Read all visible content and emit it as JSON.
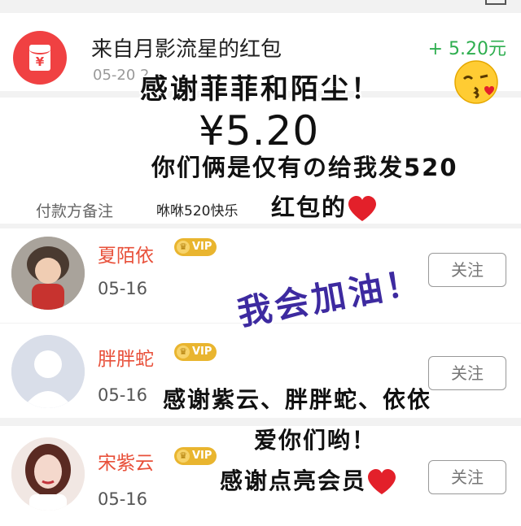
{
  "red_packet": {
    "from_title": "来自月影流星的红包",
    "amount": "+ 5.20元",
    "date": "05-20 2",
    "envelope_symbol": "¥",
    "envelope_icon": "red-envelope-icon"
  },
  "detail": {
    "amount_big": "¥5.20",
    "remark_label": "付款方备注",
    "remark_value": "咻咻520快乐"
  },
  "users": [
    {
      "name": "夏陌依",
      "vip": "VIP",
      "date": "05-16",
      "follow": "关注"
    },
    {
      "name": "胖胖蛇",
      "vip": "VIP",
      "date": "05-16",
      "follow": "关注"
    },
    {
      "name": "宋紫云",
      "vip": "VIP",
      "date": "05-16",
      "follow": "关注"
    }
  ],
  "overlay": {
    "line1": "感谢菲菲和陌尘！",
    "line2": "你们俩是仅有の给我发520",
    "line3": "红包的",
    "line4": "我会加油！",
    "line5": "感谢紫云、胖胖蛇、依依",
    "line6": "爱你们哟！",
    "line7": "感谢点亮会员"
  },
  "colors": {
    "accent_red": "#f04142",
    "amount_green": "#2eae4f",
    "username_red": "#e8503a",
    "vip_gold": "#e9b52f",
    "motivation_purple": "#3d2aa0",
    "heart_red": "#e3202a"
  }
}
